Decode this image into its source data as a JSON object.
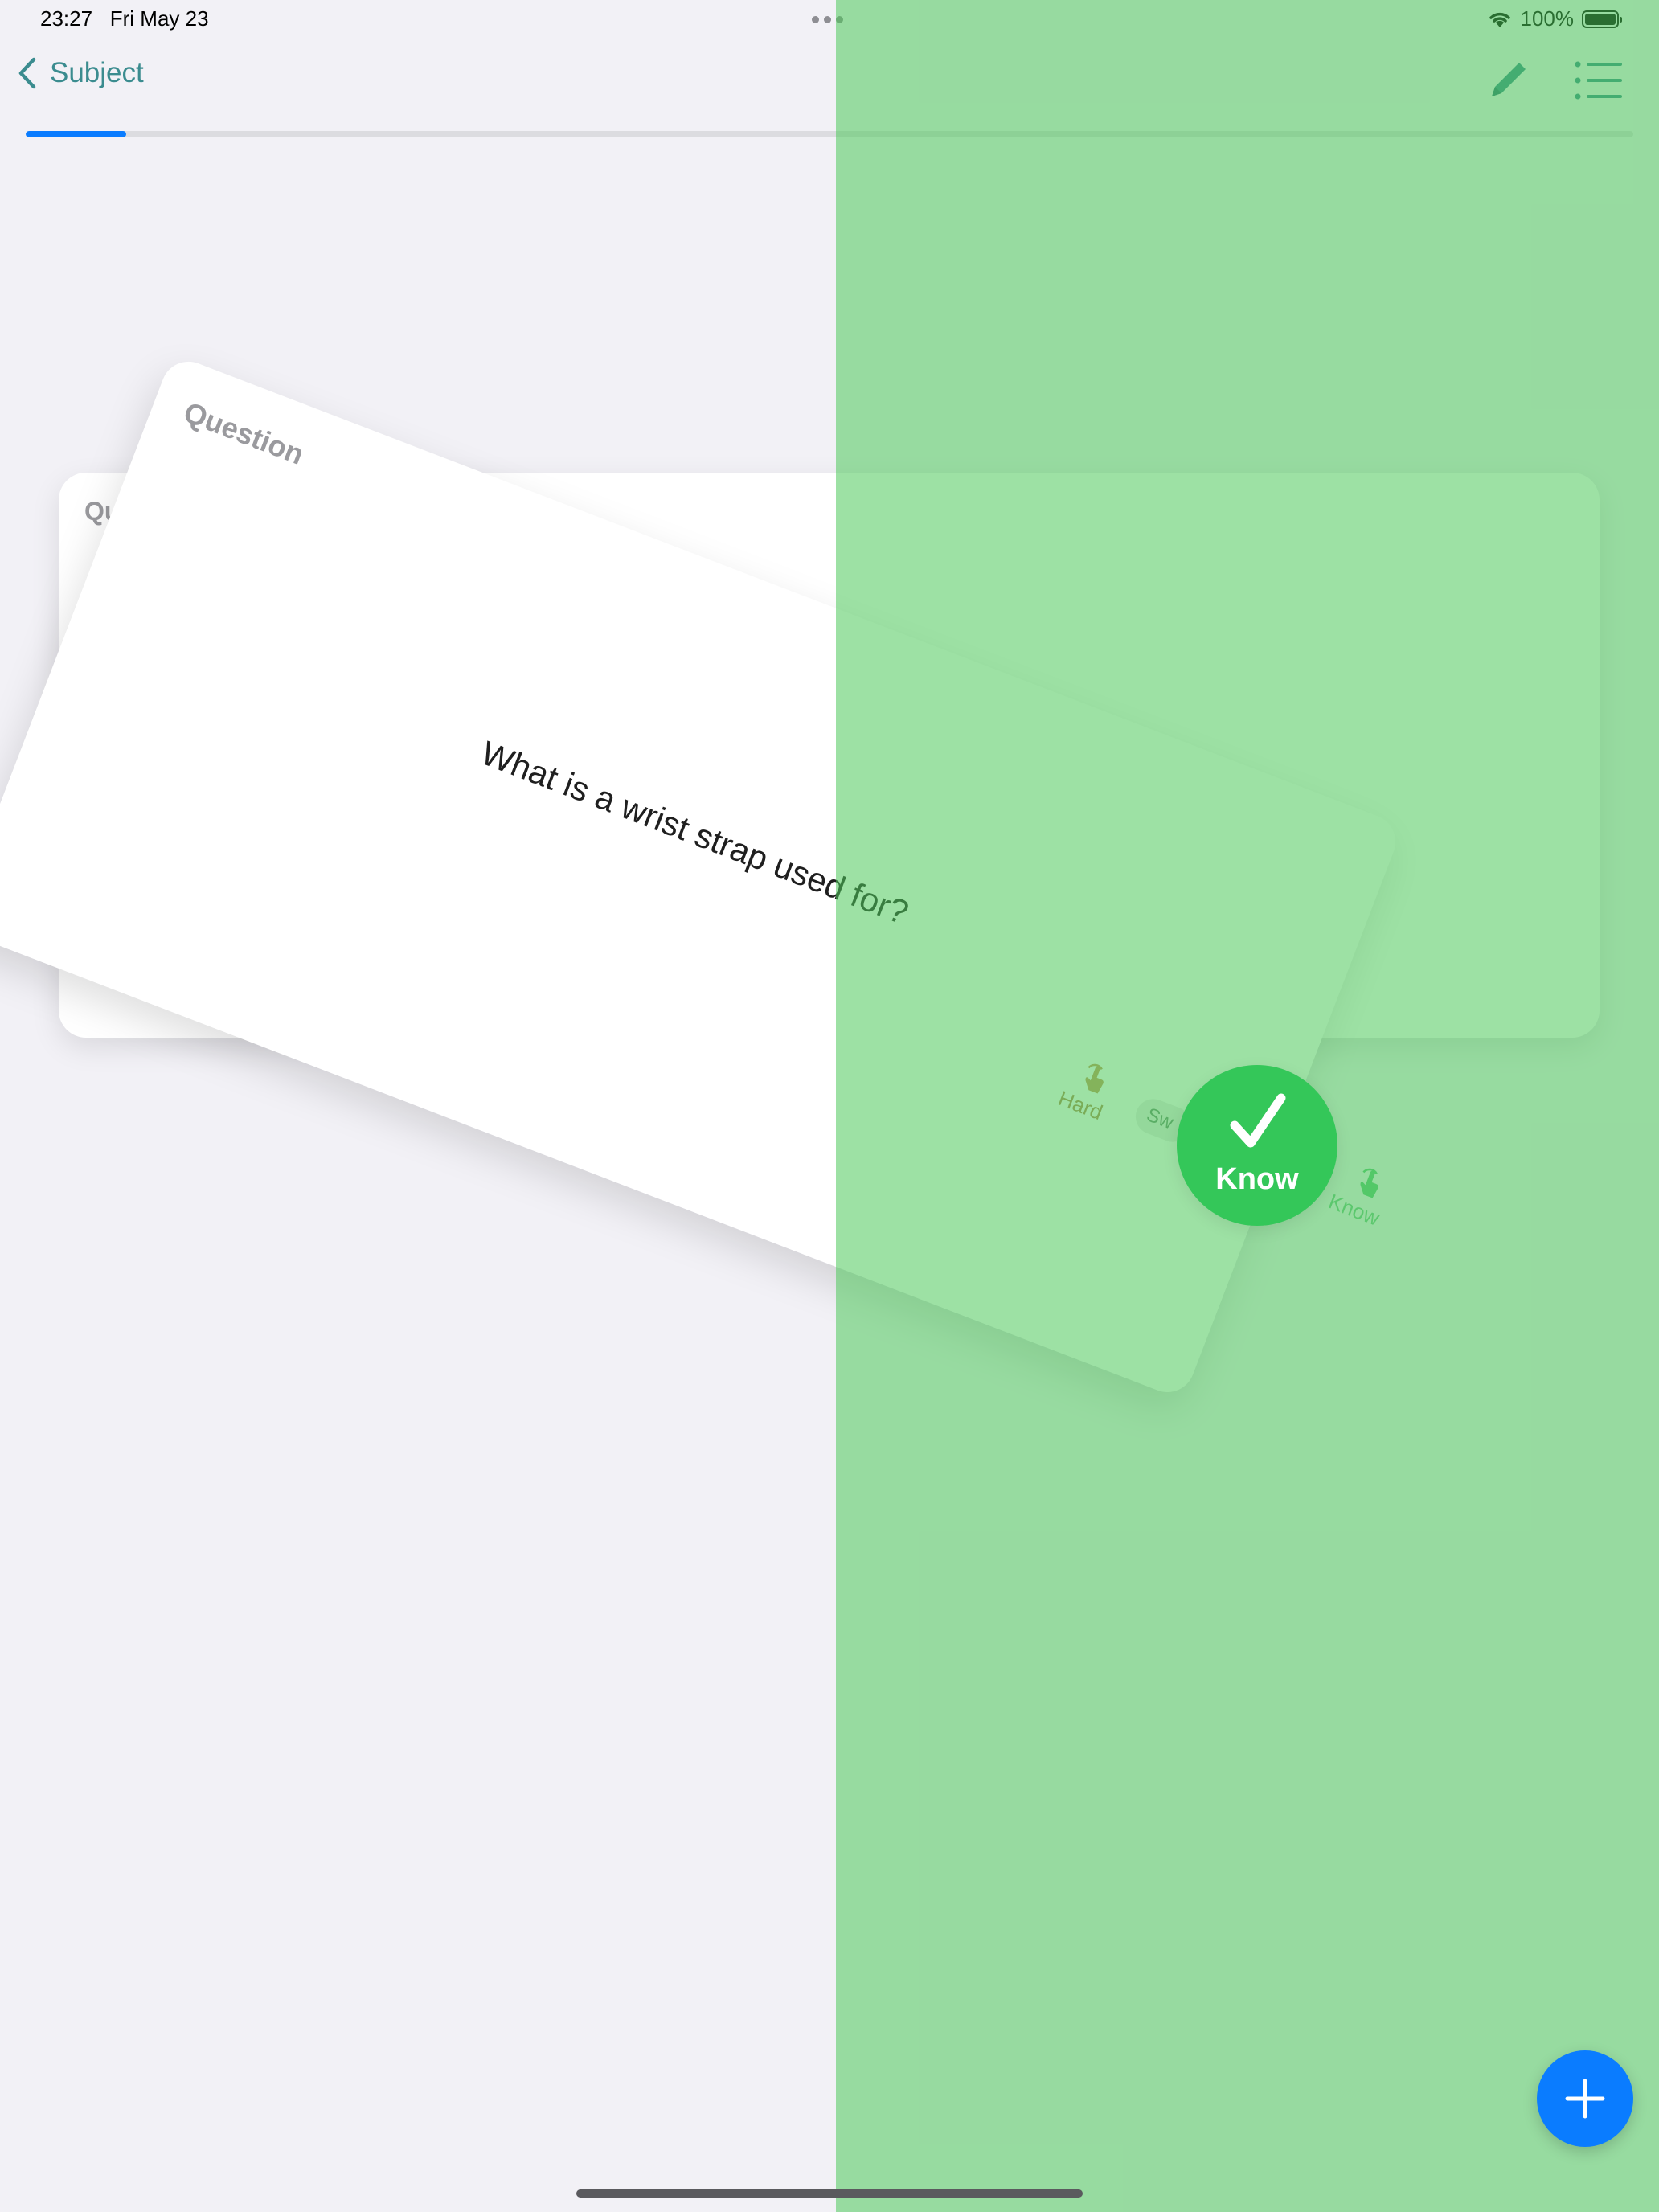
{
  "status_bar": {
    "time": "23:27",
    "date": "Fri May 23",
    "battery": "100%"
  },
  "nav": {
    "back_label": "Subject",
    "edit_icon": "pencil-icon",
    "list_icon": "list-icon"
  },
  "progress": {
    "fraction": 0.0625
  },
  "cards": {
    "back_label": "Question",
    "middle_label": "Question",
    "middle_question": "What is a wrist strap used for?"
  },
  "swipe_hints": {
    "left_label": "Hard",
    "center_label": "Sw",
    "right_label": "Know"
  },
  "know_badge": {
    "label": "Know",
    "icon": "checkmark-icon",
    "color": "#34c759"
  },
  "fab": {
    "icon": "plus-icon",
    "color": "#0a7cff"
  },
  "colors": {
    "accent": "#3b8c8f",
    "progress": "#0a7cff",
    "overlay_green": "#4cc85a"
  }
}
